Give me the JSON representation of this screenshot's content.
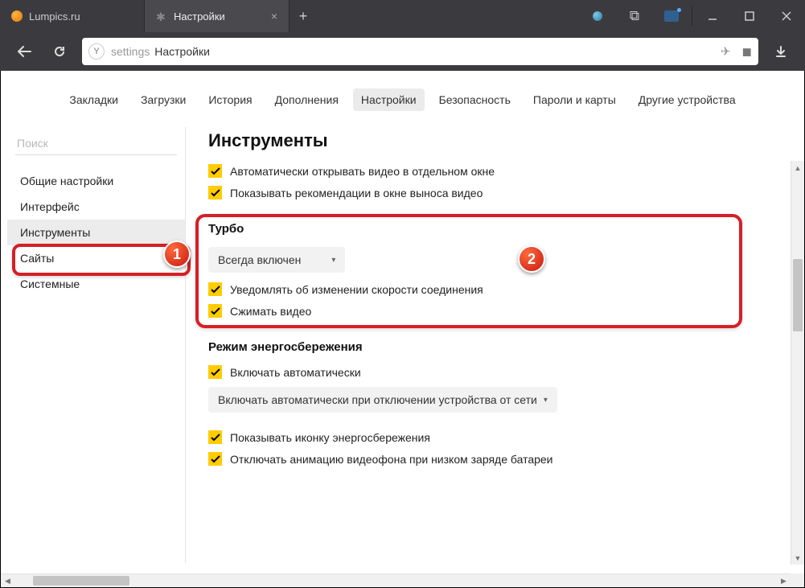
{
  "tabs": [
    {
      "title": "Lumpics.ru"
    },
    {
      "title": "Настройки"
    }
  ],
  "address": {
    "prefix": "settings",
    "page": "Настройки",
    "yandex_glyph": "Y"
  },
  "nav": {
    "items": [
      "Закладки",
      "Загрузки",
      "История",
      "Дополнения",
      "Настройки",
      "Безопасность",
      "Пароли и карты",
      "Другие устройства"
    ],
    "active_index": 4
  },
  "sidebar": {
    "search_placeholder": "Поиск",
    "items": [
      "Общие настройки",
      "Интерфейс",
      "Инструменты",
      "Сайты",
      "Системные"
    ],
    "active_index": 2
  },
  "main": {
    "title": "Инструменты",
    "top_checks": [
      "Автоматически открывать видео в отдельном окне",
      "Показывать рекомендации в окне выноса видео"
    ],
    "turbo": {
      "title": "Турбо",
      "mode": "Всегда включен",
      "checks": [
        "Уведомлять об изменении скорости соединения",
        "Сжимать видео"
      ]
    },
    "energy": {
      "title": "Режим энергосбережения",
      "auto_label": "Включать автоматически",
      "mode": "Включать автоматически при отключении устройства от сети",
      "checks": [
        "Показывать иконку энергосбережения",
        "Отключать анимацию видеофона при низком заряде батареи"
      ]
    }
  },
  "badges": {
    "one": "1",
    "two": "2"
  }
}
